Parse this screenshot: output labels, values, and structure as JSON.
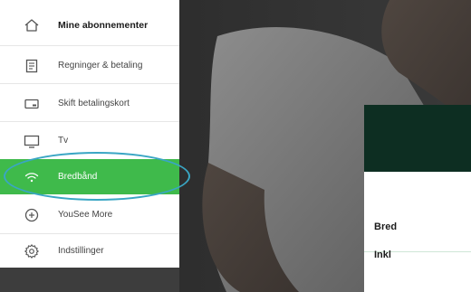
{
  "menu": {
    "items": [
      {
        "label": "Mine abonnementer",
        "icon": "home-icon"
      },
      {
        "label": "Regninger & betaling",
        "icon": "invoice-icon"
      },
      {
        "label": "Skift betalingskort",
        "icon": "payment-card-icon"
      },
      {
        "label": "Tv",
        "icon": "tv-icon"
      },
      {
        "label": "Bredbånd",
        "icon": "wifi-icon",
        "active": true
      },
      {
        "label": "YouSee More",
        "icon": "plus-circle-icon"
      },
      {
        "label": "Indstillinger",
        "icon": "settings-gear-icon"
      }
    ]
  },
  "card": {
    "row1": "Bred",
    "row2": "Inkl"
  },
  "colors": {
    "active": "#3fba4b",
    "card_header": "#0d2e22",
    "highlight_ring": "#3aa6c4"
  }
}
